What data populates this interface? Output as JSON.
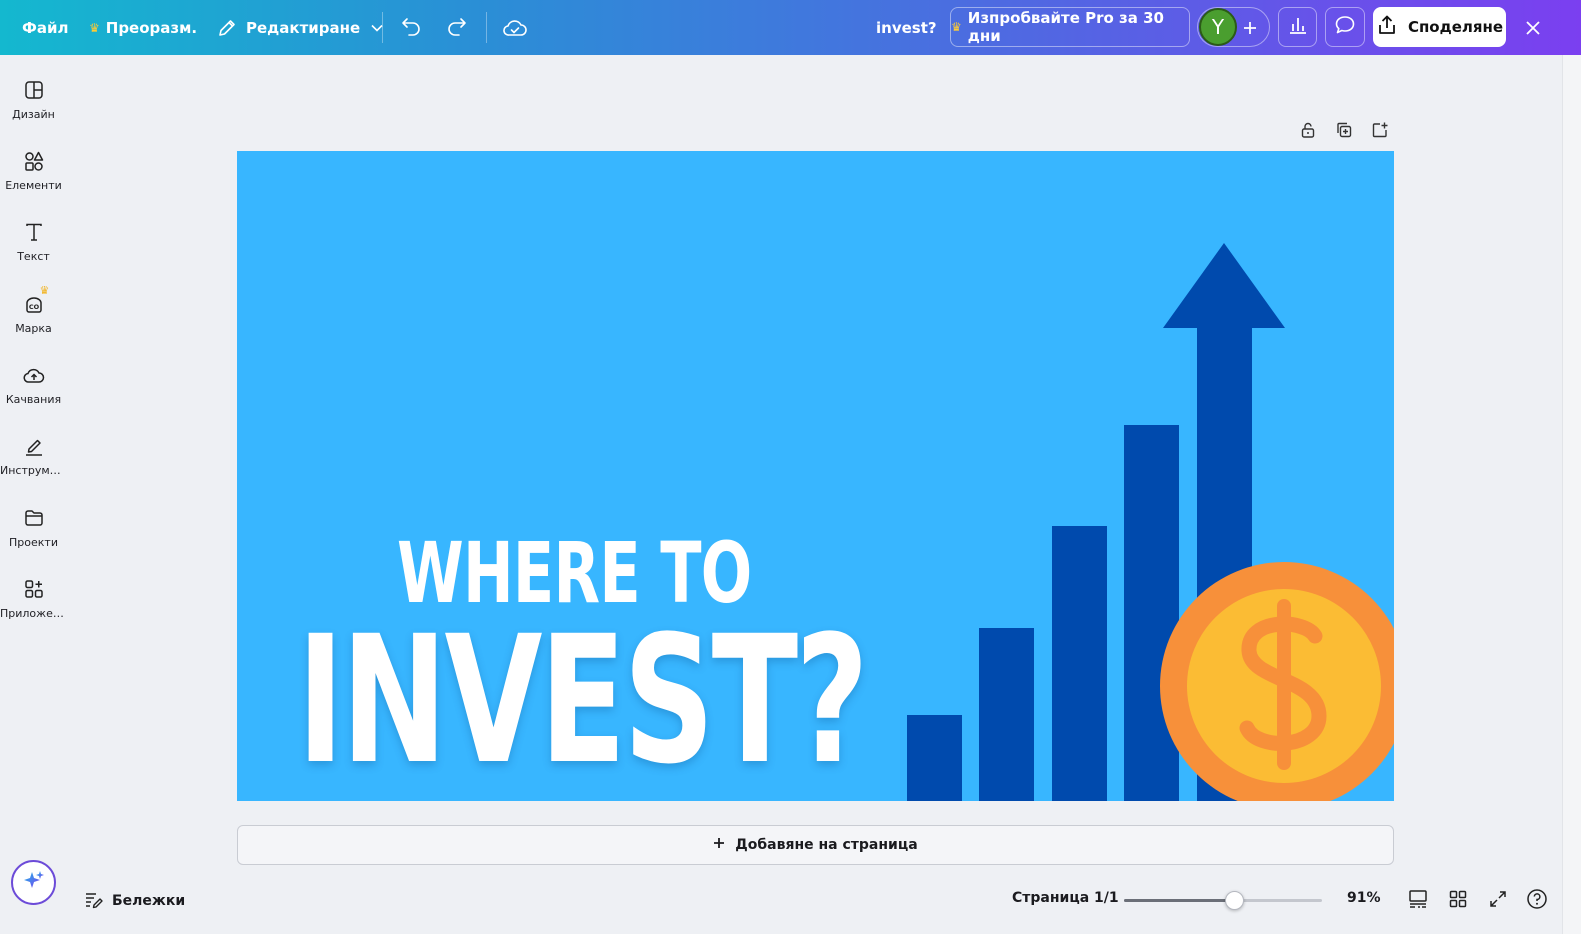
{
  "topbar": {
    "file_label": "Файл",
    "resize_label": "Преоразм.",
    "edit_label": "Редактиране",
    "doc_title": "invest?",
    "try_pro_label": "Изпробвайте Pro за 30 дни",
    "avatar_initial": "Y",
    "share_label": "Споделяне"
  },
  "sidebar": {
    "items": [
      {
        "label": "Дизайн",
        "icon": "layout-icon"
      },
      {
        "label": "Елементи",
        "icon": "shapes-icon"
      },
      {
        "label": "Текст",
        "icon": "text-icon"
      },
      {
        "label": "Марка",
        "icon": "brand-icon"
      },
      {
        "label": "Качвания",
        "icon": "upload-cloud-icon"
      },
      {
        "label": "Инструмен...",
        "icon": "draw-tool-icon"
      },
      {
        "label": "Проекти",
        "icon": "folder-icon"
      },
      {
        "label": "Приложен...",
        "icon": "apps-icon"
      }
    ]
  },
  "design": {
    "line1": "WHERE TO",
    "line2": "INVEST?",
    "background_color": "#38b6ff",
    "bar_color": "#004aad",
    "coin_outer_color": "#f7903a",
    "coin_inner_color": "#fbbc34"
  },
  "canvas": {
    "add_page_label": "Добавяне на страница"
  },
  "bottombar": {
    "notes_label": "Бележки",
    "page_indicator": "Страница 1/1",
    "zoom_label": "91%",
    "zoom_fraction": 0.56
  }
}
